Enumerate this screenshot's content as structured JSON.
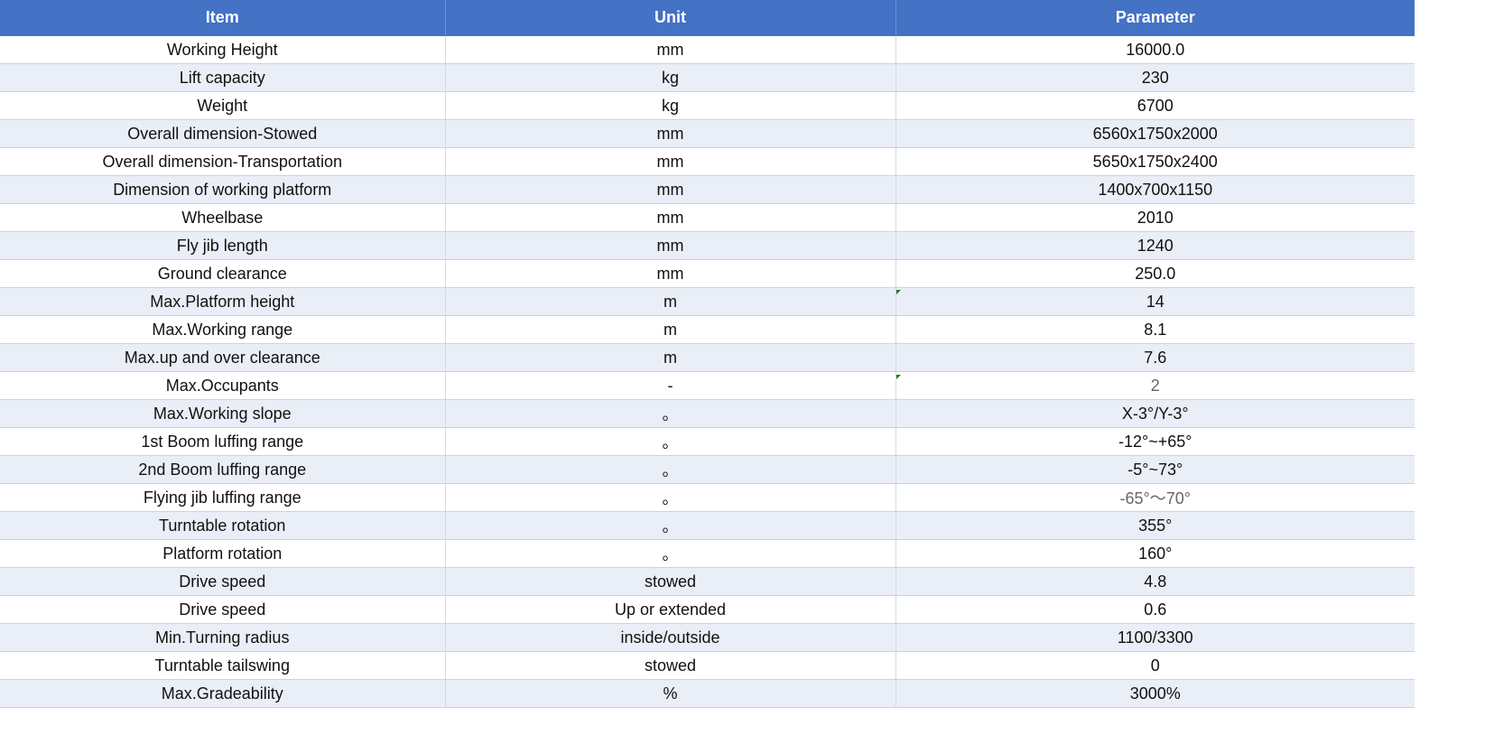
{
  "table": {
    "headers": {
      "item": "Item",
      "unit": "Unit",
      "parameter": "Parameter"
    },
    "rows": [
      {
        "item": "Working Height",
        "unit": "mm",
        "parameter": "16000.0"
      },
      {
        "item": "Lift capacity",
        "unit": "kg",
        "parameter": "230"
      },
      {
        "item": "Weight",
        "unit": "kg",
        "parameter": "6700"
      },
      {
        "item": "Overall dimension-Stowed",
        "unit": "mm",
        "parameter": "6560x1750x2000"
      },
      {
        "item": "Overall dimension-Transportation",
        "unit": "mm",
        "parameter": "5650x1750x2400"
      },
      {
        "item": "Dimension of working platform",
        "unit": "mm",
        "parameter": "1400x700x1150"
      },
      {
        "item": "Wheelbase",
        "unit": "mm",
        "parameter": "2010"
      },
      {
        "item": "Fly jib length",
        "unit": "mm",
        "parameter": "1240"
      },
      {
        "item": "Ground clearance",
        "unit": "mm",
        "parameter": "250.0"
      },
      {
        "item": "Max.Platform height",
        "unit": "m",
        "parameter": "14"
      },
      {
        "item": "Max.Working range",
        "unit": "m",
        "parameter": "8.1"
      },
      {
        "item": "Max.up and over clearance",
        "unit": "m",
        "parameter": "7.6"
      },
      {
        "item": "Max.Occupants",
        "unit": "-",
        "parameter": "2"
      },
      {
        "item": "Max.Working slope",
        "unit": "。",
        "parameter": "X-3°/Y-3°"
      },
      {
        "item": "1st Boom luffing range",
        "unit": "。",
        "parameter": "-12°~+65°"
      },
      {
        "item": "2nd Boom luffing range",
        "unit": "。",
        "parameter": "-5°~73°"
      },
      {
        "item": "Flying jib luffing range",
        "unit": "。",
        "parameter": "-65°～70°"
      },
      {
        "item": "Turntable rotation",
        "unit": "。",
        "parameter": "355°"
      },
      {
        "item": "Platform rotation",
        "unit": "。",
        "parameter": "160°"
      },
      {
        "item": "Drive speed",
        "unit": "stowed",
        "parameter": "4.8"
      },
      {
        "item": "Drive speed",
        "unit": "Up or extended",
        "parameter": "0.6"
      },
      {
        "item": "Min.Turning radius",
        "unit": "inside/outside",
        "parameter": "1100/3300"
      },
      {
        "item": "Turntable tailswing",
        "unit": "stowed",
        "parameter": "0"
      },
      {
        "item": "Max.Gradeability",
        "unit": "%",
        "parameter": "3000%"
      }
    ]
  },
  "colors": {
    "header_bg": "#4472c4",
    "header_text": "#ffffff",
    "band_row_bg": "#e9eef7",
    "grid_line": "#c9d2e3"
  }
}
